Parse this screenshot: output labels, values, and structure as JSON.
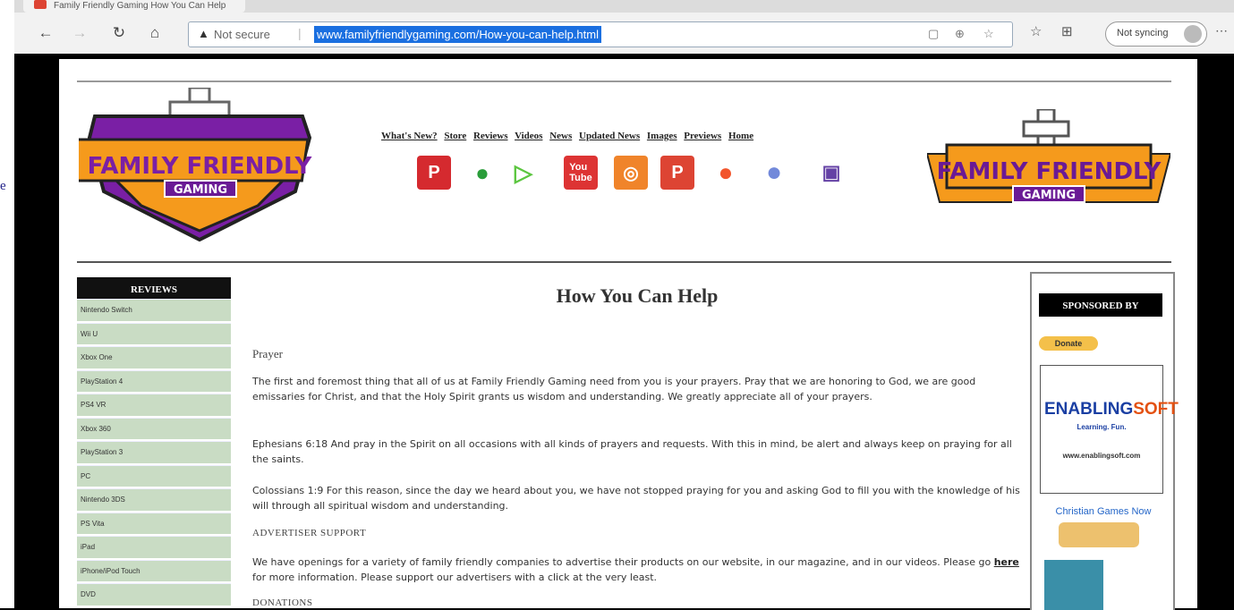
{
  "left_gutter": {
    "stray_char": "e"
  },
  "browser": {
    "tab_title": "Family Friendly Gaming How You Can Help",
    "not_secure": "Not secure",
    "url": "www.familyfriendlygaming.com/How-you-can-help.html",
    "sync_label": "Not syncing"
  },
  "nav": [
    "What's New?",
    "Store",
    "Reviews",
    "Videos",
    "News",
    "Updated News",
    "Images",
    "Previews",
    "Home"
  ],
  "logo": {
    "line1": "FAMILY FRIENDLY",
    "line2": "GAMING"
  },
  "social_icons": [
    "parler-icon",
    "frog-icon",
    "rumble-icon",
    "youtube-icon",
    "camera-icon",
    "pinterest-icon",
    "patreon-icon",
    "discord-icon",
    "twitch-icon"
  ],
  "sidebar": {
    "heading": "REVIEWS",
    "items": [
      "Nintendo Switch",
      "Wii U",
      "Xbox One",
      "PlayStation 4",
      "PS4 VR",
      "Xbox 360",
      "PlayStation 3",
      "PC",
      "Nintendo 3DS",
      "PS Vita",
      "iPad",
      "iPhone/iPod Touch",
      "DVD"
    ]
  },
  "content": {
    "title": "How You Can Help",
    "prayer_heading": "Prayer",
    "p1": "The first and foremost thing that all of us at Family Friendly Gaming need from you is your prayers. Pray that we are honoring to God, we are good emissaries for Christ, and that the Holy Spirit grants us wisdom and understanding. We greatly appreciate all of your prayers.",
    "p2": "Ephesians 6:18 And pray in the Spirit on all occasions with all kinds of prayers and requests. With this in mind, be alert and always keep on praying for all the saints.",
    "p3": "Colossians 1:9 For this reason, since the day we heard about you, we have not stopped praying for you and asking God to fill you with the knowledge of his will through all spiritual wisdom and understanding.",
    "advertiser_heading": "ADVERTISER SUPPORT",
    "p4_before": "We have openings for a variety of family friendly companies to advertise their products on our website, in our magazine, and in our videos. Please go ",
    "p4_link": "here",
    "p4_after": " for more information. Please support our advertisers with a click at the very least.",
    "donations_heading": "DONATIONS"
  },
  "right": {
    "sponsored": "SPONSORED BY",
    "donate": "Donate",
    "ad_brand_a": "ENABLING",
    "ad_brand_b": "SOFT",
    "ad_tagline": "Learning. Fun.",
    "ad_site": "www.enablingsoft.com",
    "cgn": "Christian Games Now"
  },
  "colors": {
    "brand_purple": "#8a2bb0",
    "brand_orange": "#f59a1c",
    "link_blue": "#1a6fe0"
  }
}
